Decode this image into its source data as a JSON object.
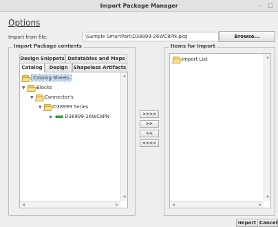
{
  "window": {
    "title": "Import Package Manager",
    "minimize_glyph": "–",
    "maximize_glyph": "□"
  },
  "options_label": "Options",
  "import_from_file": {
    "label": "Import from file:",
    "value": "\\Sample SmartPart\\D38999-26WC8PN.pkg",
    "browse_label": "Browse..."
  },
  "contents_group": {
    "title": "Import Package contents",
    "tabs_row1": [
      "Design Snippets",
      "Datatables and Maps"
    ],
    "tabs_row2": [
      "Catalog",
      "Design",
      "Shapeless Artifacts"
    ],
    "selected_tab": "Catalog",
    "tree": [
      {
        "label": "Catalog Sheets",
        "level": 0,
        "expanded": true,
        "icon": "folder-icon",
        "selected": true
      },
      {
        "label": "Blocks",
        "level": 1,
        "expanded": true,
        "icon": "folder-icon"
      },
      {
        "label": "Connector's",
        "level": 2,
        "expanded": true,
        "icon": "folder-icon"
      },
      {
        "label": "D38999 Series",
        "level": 3,
        "expanded": true,
        "icon": "folder-icon"
      },
      {
        "label": "D38999-26WC8PN",
        "level": 4,
        "expanded": false,
        "icon": "connector-part-icon"
      }
    ]
  },
  "transfer_buttons": [
    ">>>>",
    ">>",
    "<<",
    "<<<<"
  ],
  "items_group": {
    "title": "Items for Import",
    "tree": [
      {
        "label": "Import List",
        "icon": "folder-icon"
      }
    ]
  },
  "footer": {
    "import_label": "Import",
    "cancel_label": "Cancel"
  },
  "colors": {
    "folder": "#f1d36a",
    "part_icon": "#1aa11a",
    "selection": "#c8ddf2"
  }
}
